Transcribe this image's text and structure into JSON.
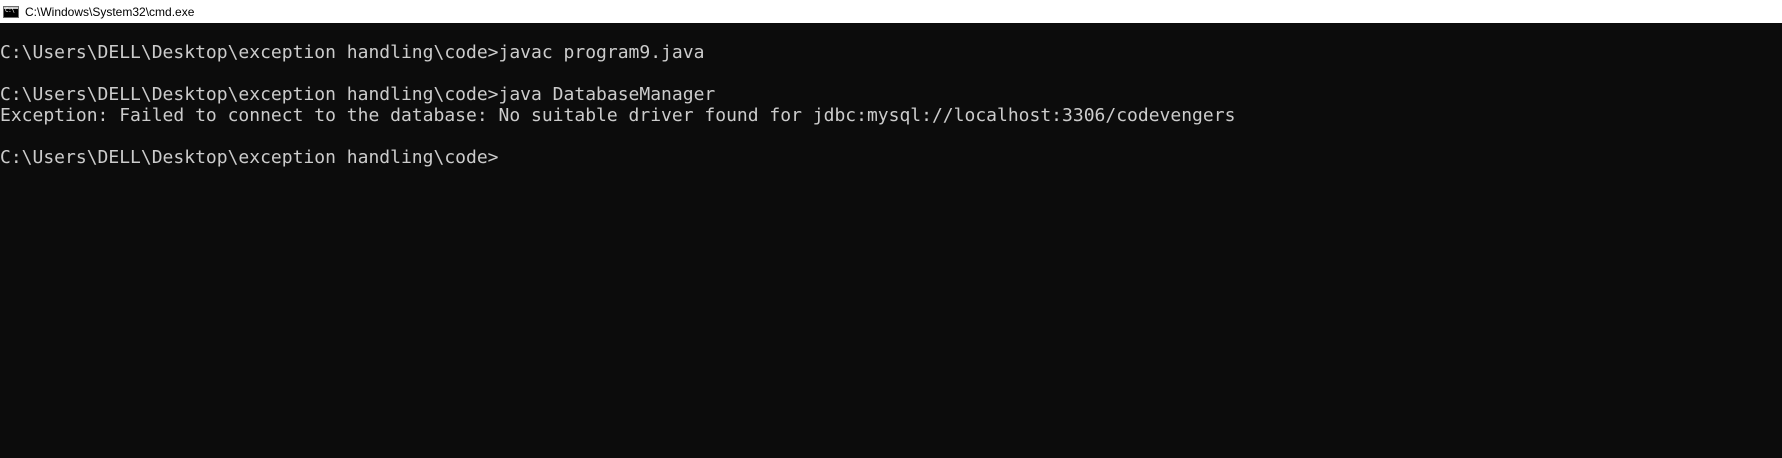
{
  "window": {
    "title": "C:\\Windows\\System32\\cmd.exe",
    "icon": "cmd-console-icon"
  },
  "console": {
    "lines": [
      "C:\\Users\\DELL\\Desktop\\exception handling\\code>javac program9.java",
      "C:\\Users\\DELL\\Desktop\\exception handling\\code>java DatabaseManager",
      "Exception: Failed to connect to the database: No suitable driver found for jdbc:mysql://localhost:3306/codevengers",
      "C:\\Users\\DELL\\Desktop\\exception handling\\code>"
    ]
  },
  "colors": {
    "background": "#0c0c0c",
    "text": "#cccccc",
    "titlebar": "#ffffff"
  }
}
